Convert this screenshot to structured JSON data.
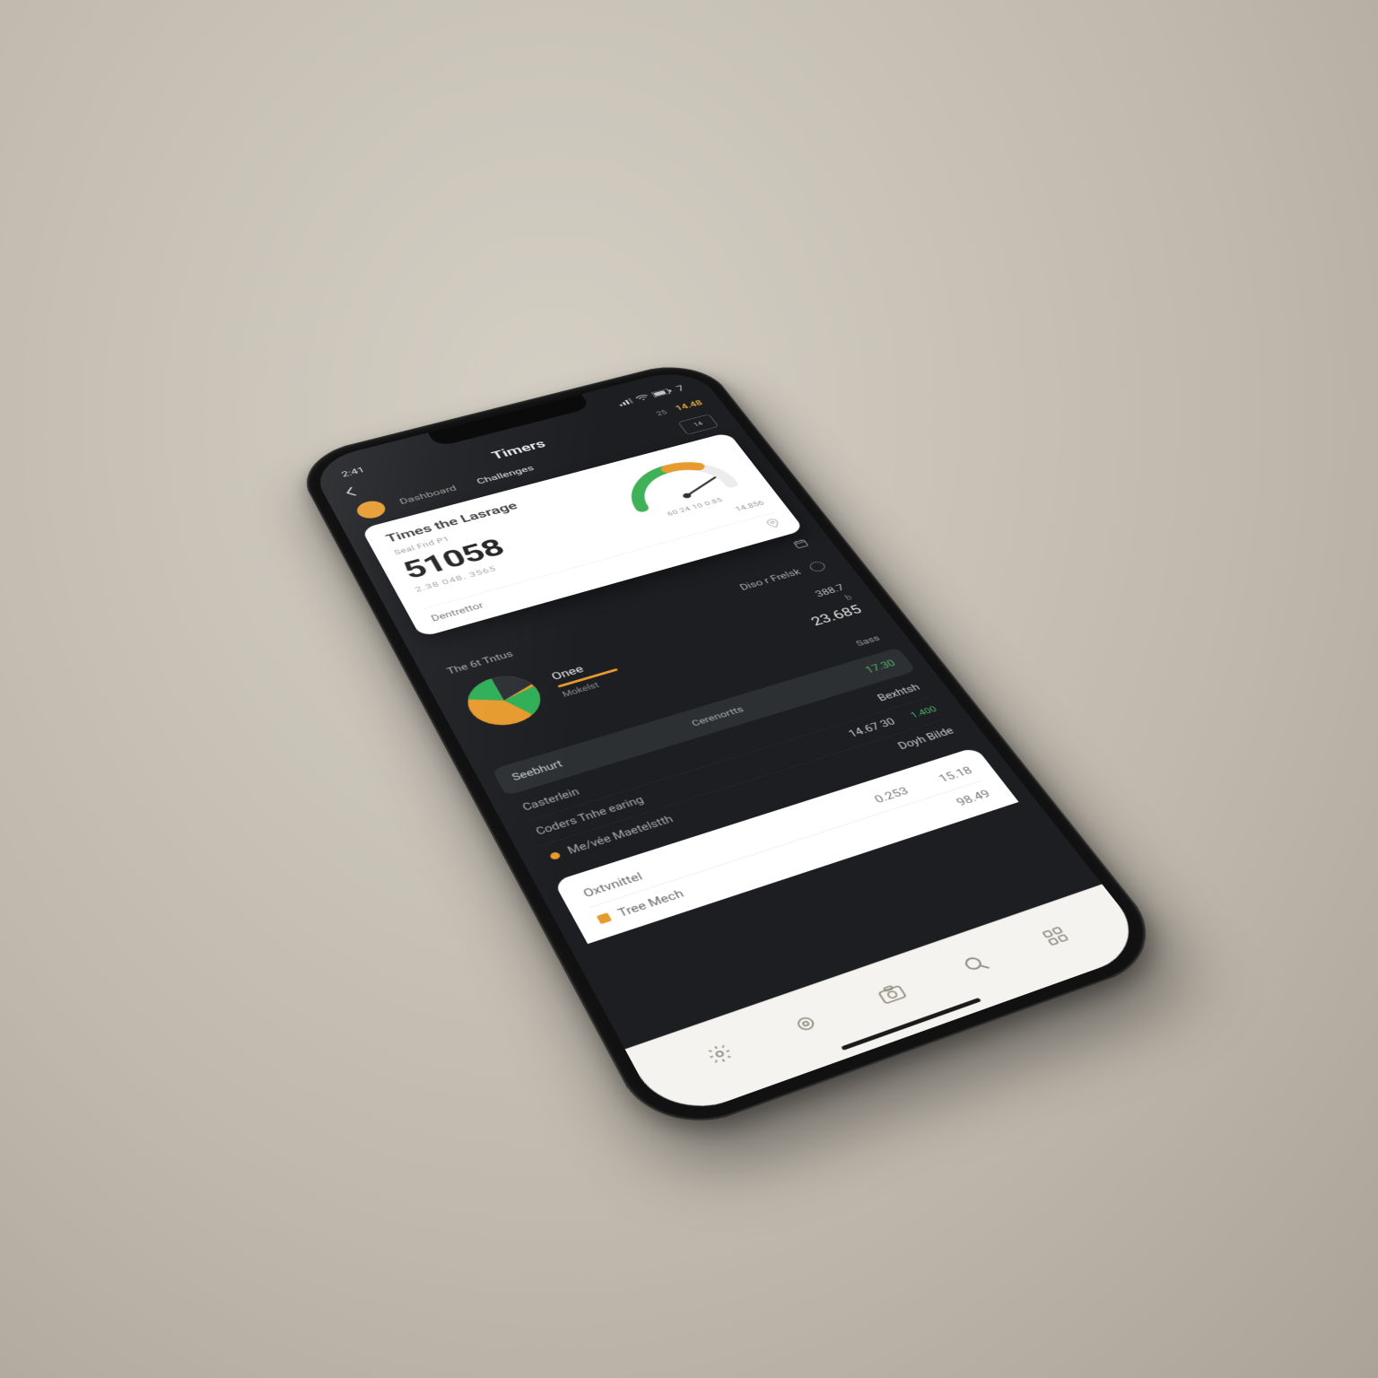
{
  "status": {
    "time": "2:41",
    "battery_icon": "batt",
    "wifi_icon": "wifi",
    "signal_icon": "sig",
    "aux": "7"
  },
  "nav": {
    "title": "Timers",
    "meta_small": "25",
    "meta_gold": "14.48",
    "tabs": {
      "tab1": "Dashboard",
      "tab2": "Challenges"
    },
    "toggle_label": "14"
  },
  "card": {
    "title": "Times the Lasrage",
    "subtitle": "Seal Fnd P1",
    "value": "51058",
    "subvalue": "2.38 048. 3565",
    "gauge_caption": "60 24 10 0:85",
    "gauge_side": "14.856",
    "footer_label": "Dentrettor"
  },
  "chart_data": {
    "gauge": {
      "type": "pie",
      "title": "Times the Lasrage",
      "series": [
        {
          "name": "green",
          "value": 50,
          "color": "#3fb157"
        },
        {
          "name": "orange",
          "value": 18,
          "color": "#e79a2d"
        },
        {
          "name": "remain",
          "value": 32,
          "color": "#e9e9e9"
        }
      ],
      "style": "semicircle-gauge",
      "needle_fraction": 0.62
    },
    "pie": {
      "type": "pie",
      "series": [
        {
          "name": "green",
          "value": 35,
          "color": "#2fae57"
        },
        {
          "name": "orange",
          "value": 45,
          "color": "#e79a2d"
        },
        {
          "name": "dark",
          "value": 20,
          "color": "#2c2f33"
        }
      ]
    }
  },
  "sections": {
    "s1_left": "The 6t Tntus",
    "s1_right_a": "Diso r Frelsk",
    "once": {
      "title": "Onee",
      "sub": "Mokelst",
      "num_small": "388.7",
      "num_mid": "b",
      "num_big": "23.685"
    },
    "sass": "Sass",
    "hl": {
      "label": "Seebhurt",
      "mid": "Cerenortts",
      "right": "17.30"
    },
    "rows": [
      {
        "k": "Casterlein",
        "v": "Bexhtsh",
        "green": false
      },
      {
        "k": "Coders Tnhe earing",
        "v": "14.67 30",
        "green": false,
        "extra": "1.400",
        "extra_green": true
      },
      {
        "k": "Me/vée Maetelstth",
        "v": "Doyh Bilde",
        "dot": true
      }
    ]
  },
  "bottom": {
    "r1_k": "Oxtvnittel",
    "r1_v1": "0.253",
    "r1_v2": "15.18",
    "r2_k": "Tree Mech",
    "r2_v": "98.49"
  },
  "tabbar": {
    "a": "home",
    "b": "camera",
    "c": "search",
    "d": "grid"
  }
}
